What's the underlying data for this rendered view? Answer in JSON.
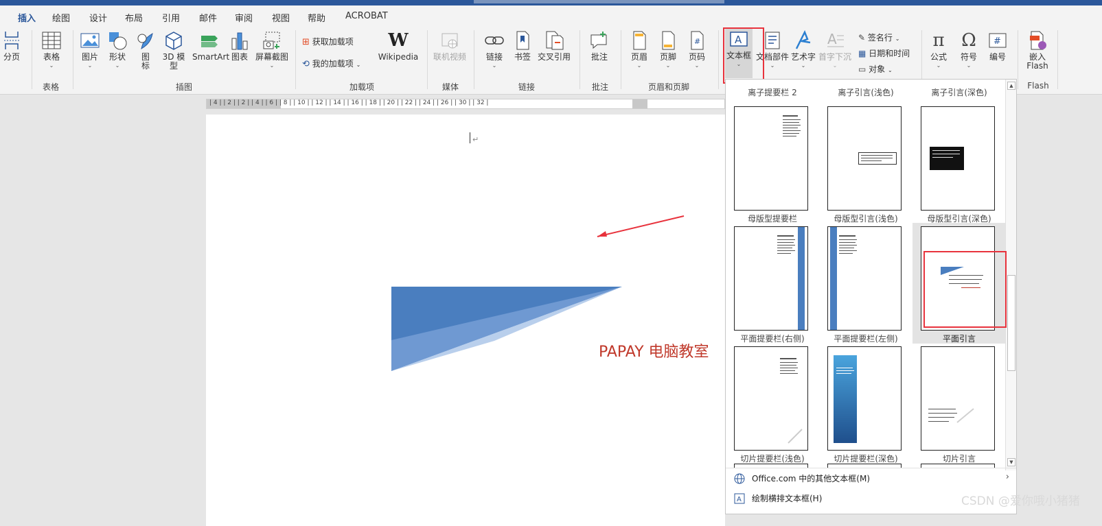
{
  "tabs": [
    {
      "label": "插入",
      "active": true
    },
    {
      "label": "绘图"
    },
    {
      "label": "设计"
    },
    {
      "label": "布局"
    },
    {
      "label": "引用"
    },
    {
      "label": "邮件"
    },
    {
      "label": "审阅"
    },
    {
      "label": "视图"
    },
    {
      "label": "帮助"
    },
    {
      "label": "ACROBAT"
    }
  ],
  "ribbon": {
    "page_break": "分页",
    "table": "表格",
    "picture": "图片",
    "shapes": "形状",
    "icons_1": "图",
    "icons_2": "标",
    "model3d_1": "3D 模",
    "model3d_2": "型",
    "smartart": "SmartArt",
    "chart": "图表",
    "screenshot": "屏幕截图",
    "get_addins": "获取加载项",
    "my_addins": "我的加载项",
    "wikipedia": "Wikipedia",
    "online_video": "联机视频",
    "link": "链接",
    "bookmark": "书签",
    "cross_ref": "交叉引用",
    "comment": "批注",
    "header": "页眉",
    "footer": "页脚",
    "page_number": "页码",
    "textbox": "文本框",
    "quick_parts": "文档部件",
    "wordart": "艺术字",
    "dropcap": "首字下沉",
    "signature": "签名行",
    "datetime": "日期和时间",
    "object": "对象",
    "equation": "公式",
    "symbol": "符号",
    "number": "编号",
    "embed_flash_1": "嵌入",
    "embed_flash_2": "Flash"
  },
  "groups": {
    "tables": "表格",
    "illustrations": "插图",
    "addins": "加载项",
    "media": "媒体",
    "links": "链接",
    "comments": "批注",
    "header_footer": "页眉和页脚",
    "flash": "Flash"
  },
  "ruler_numbers": "| 4 | | 2 |     | 2 | | 4 | | 6 | | 8 | | 10 | | 12 | | 14 | | 16 | | 18 | | 20 | | 22 | | 24 | | 26 |      | 30 | | 32 |",
  "document": {
    "papay_text": "PAPAY 电脑教室",
    "para_mark": "↵"
  },
  "gallery": {
    "top_row": [
      "离子提要栏 2",
      "离子引言(浅色)",
      "离子引言(深色)"
    ],
    "items": [
      {
        "label": "母版型提要栏"
      },
      {
        "label": "母版型引言(浅色)"
      },
      {
        "label": "母版型引言(深色)"
      },
      {
        "label": "平面提要栏(右侧)"
      },
      {
        "label": "平面提要栏(左侧)"
      },
      {
        "label": "平面引言",
        "selected": true
      },
      {
        "label": "切片提要栏(浅色)"
      },
      {
        "label": "切片提要栏(深色)"
      },
      {
        "label": "切片引言"
      }
    ]
  },
  "menu": {
    "more_textboxes": "Office.com 中的其他文本框(M)",
    "draw_textbox": "绘制横排文本框(H)"
  },
  "watermark": "CSDN @爱你哦小猪猪",
  "colors": {
    "accent": "#2b579a",
    "highlight": "#e8323c",
    "papay": "#c0392b",
    "chart_blue": "#4a7ebf"
  }
}
